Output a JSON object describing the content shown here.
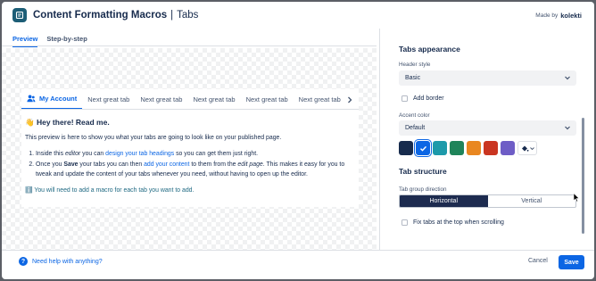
{
  "header": {
    "title": "Content Formatting Macros",
    "subtitle": "Tabs",
    "made_by_label": "Made by",
    "made_by_brand": "kolekti"
  },
  "preview": {
    "mode_tabs": [
      "Preview",
      "Step-by-step"
    ],
    "active_mode": "Preview",
    "tabs": [
      "My Account",
      "Next great tab",
      "Next great tab",
      "Next great tab",
      "Next great tab",
      "Next great tab",
      "Ne"
    ],
    "active_tab_index": 0,
    "content": {
      "greeting": "Hey there! Read me.",
      "greeting_emoji": "👋",
      "intro": "This preview is here to show you what your tabs are going to look like on your published page.",
      "step1": {
        "t1": "Inside this ",
        "em1": "editor",
        "t2": " you can ",
        "link": "design your tab headings",
        "t3": " so you can get them just right."
      },
      "step2": {
        "t1": "Once you ",
        "bold": "Save",
        "t2": " your tabs you can then ",
        "link": "add your content",
        "t3": " to them from the ",
        "em": "edit page",
        "t4": ". This makes it easy for you to tweak and update the content of your tabs whenever you need, without having to open up the editor."
      },
      "note_icon": "ℹ️",
      "note": "You will need to add a macro for each tab you want to add."
    }
  },
  "settings": {
    "appearance_title": "Tabs appearance",
    "header_style_label": "Header style",
    "header_style_value": "Basic",
    "add_border_label": "Add border",
    "add_border_checked": false,
    "accent_color_label": "Accent color",
    "accent_color_value": "Default",
    "swatches": [
      {
        "color": "#172b4d",
        "selected": false
      },
      {
        "color": "#0c66e4",
        "selected": true
      },
      {
        "color": "#1d9aaa",
        "selected": false
      },
      {
        "color": "#1f845a",
        "selected": false
      },
      {
        "color": "#e98720",
        "selected": false
      },
      {
        "color": "#ca3521",
        "selected": false
      },
      {
        "color": "#6e5dc6",
        "selected": false
      }
    ],
    "structure_title": "Tab structure",
    "direction_label": "Tab group direction",
    "direction_options": [
      "Horizontal",
      "Vertical"
    ],
    "direction_selected": "Horizontal",
    "fix_tabs_label": "Fix tabs at the top when scrolling",
    "fix_tabs_checked": false
  },
  "footer": {
    "help_label": "Need help with anything?",
    "cancel_label": "Cancel",
    "save_label": "Save"
  },
  "colors": {
    "accent": "#0c66e4",
    "app_icon": "#1c5d76",
    "segment_active": "#1d2b4f"
  }
}
